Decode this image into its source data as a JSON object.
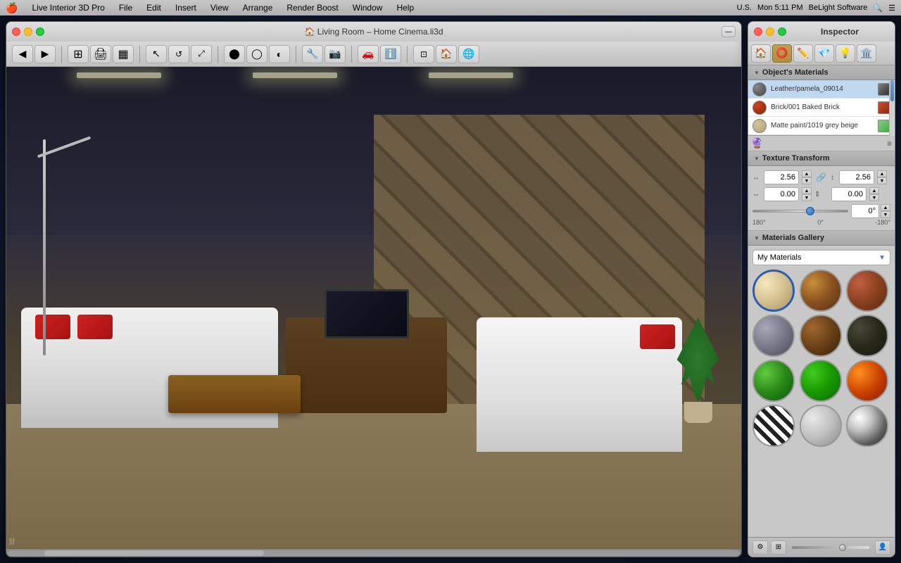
{
  "menubar": {
    "apple": "🍎",
    "items": [
      {
        "label": "Live Interior 3D Pro"
      },
      {
        "label": "File"
      },
      {
        "label": "Edit"
      },
      {
        "label": "Insert"
      },
      {
        "label": "View"
      },
      {
        "label": "Arrange"
      },
      {
        "label": "Render Boost"
      },
      {
        "label": "Window"
      },
      {
        "label": "Help"
      }
    ],
    "right": {
      "time": "Mon 5:11 PM",
      "brand": "BeLight Software",
      "locale": "U.S."
    }
  },
  "main_window": {
    "title": "Living Room – Home Cinema.li3d",
    "traffic": [
      "red",
      "yellow",
      "green"
    ]
  },
  "inspector": {
    "title": "Inspector",
    "tabs": [
      {
        "icon": "🏠",
        "label": "object"
      },
      {
        "icon": "⭕",
        "label": "material"
      },
      {
        "icon": "✏️",
        "label": "edit"
      },
      {
        "icon": "💎",
        "label": "texture"
      },
      {
        "icon": "💡",
        "label": "light"
      },
      {
        "icon": "🏛️",
        "label": "scene"
      }
    ],
    "objects_materials": {
      "label": "Object's Materials",
      "items": [
        {
          "name": "Leather/pamela_09014",
          "swatch": "grey"
        },
        {
          "name": "Brick/001 Baked Brick",
          "swatch": "red"
        },
        {
          "name": "Matte paint/1019 grey beige",
          "swatch": "beige"
        }
      ]
    },
    "texture_transform": {
      "label": "Texture Transform",
      "scale_x": "2.56",
      "scale_y": "2.56",
      "offset_x": "0.00",
      "offset_y": "0.00",
      "rotation_value": "0°",
      "rotation_min": "180°",
      "rotation_center": "0°",
      "rotation_max": "-180°"
    },
    "materials_gallery": {
      "label": "Materials Gallery",
      "dropdown_value": "My Materials",
      "spheres": [
        {
          "type": "cream",
          "label": "cream"
        },
        {
          "type": "wood1",
          "label": "wood light"
        },
        {
          "type": "brick",
          "label": "brick"
        },
        {
          "type": "stone",
          "label": "stone"
        },
        {
          "type": "wood2",
          "label": "wood medium"
        },
        {
          "type": "dark",
          "label": "dark"
        },
        {
          "type": "green1",
          "label": "green matte"
        },
        {
          "type": "green2",
          "label": "green bright"
        },
        {
          "type": "fire",
          "label": "fire"
        },
        {
          "type": "zebra",
          "label": "zebra"
        },
        {
          "type": "spots",
          "label": "spots"
        },
        {
          "type": "chrome",
          "label": "chrome"
        }
      ]
    }
  }
}
